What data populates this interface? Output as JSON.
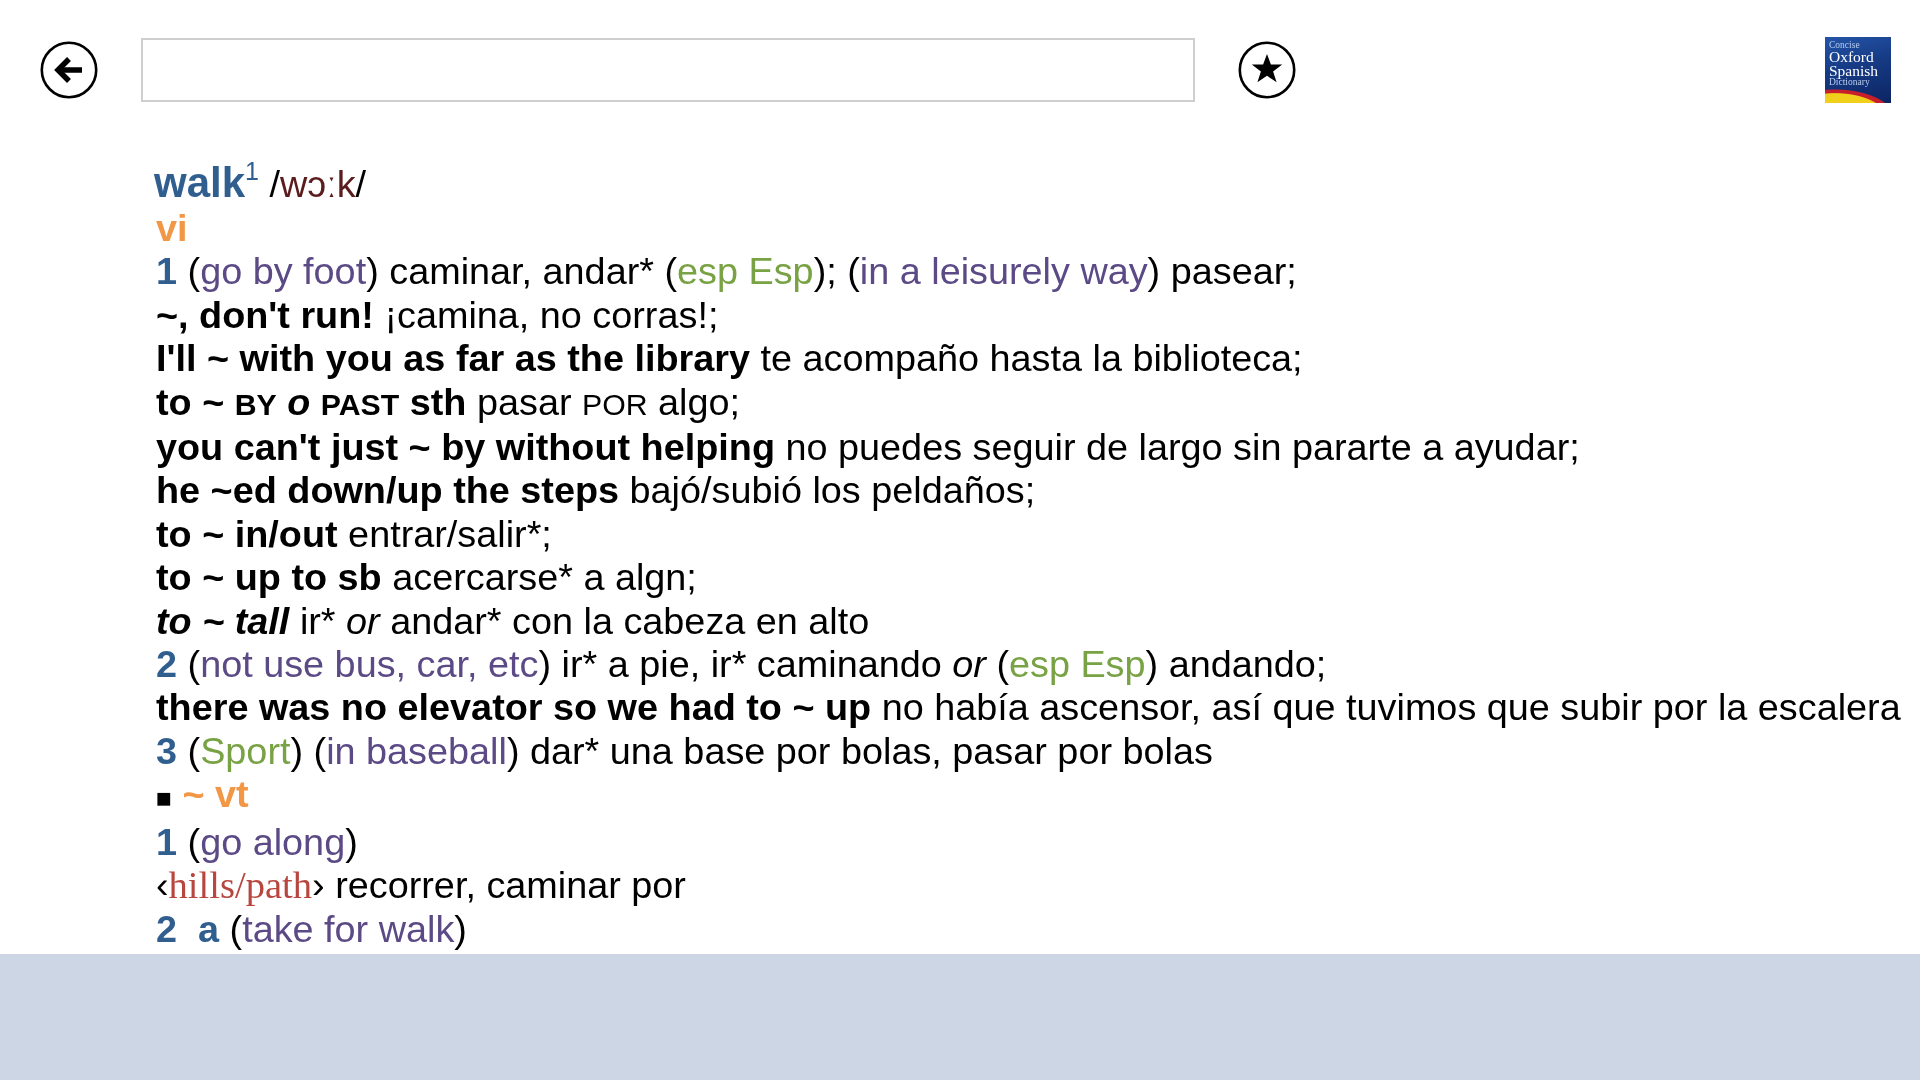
{
  "logo": {
    "lines": [
      {
        "kind": "minor",
        "text": "Concise"
      },
      {
        "kind": "major",
        "text": "Oxford"
      },
      {
        "kind": "major",
        "text": "Spanish"
      },
      {
        "kind": "minor",
        "text": "Dictionary"
      }
    ]
  },
  "entry": {
    "lines": [
      {
        "kind": "headword",
        "segments": [
          {
            "kind": "headword",
            "text": "walk"
          },
          {
            "kind": "homograph",
            "text": "1"
          },
          {
            "kind": "plain",
            "text": " /"
          },
          {
            "kind": "phonetic",
            "text": "wɔːk"
          },
          {
            "kind": "plain",
            "text": "/"
          }
        ]
      },
      {
        "kind": "pos",
        "segments": [
          {
            "kind": "pos",
            "text": "vi"
          }
        ]
      },
      {
        "kind": "sense",
        "segments": [
          {
            "kind": "number",
            "text": "1"
          },
          {
            "kind": "plain",
            "text": " ("
          },
          {
            "kind": "indicator",
            "text": "go by foot"
          },
          {
            "kind": "plain",
            "text": ") caminar, andar* ("
          },
          {
            "kind": "label",
            "text": "esp Esp"
          },
          {
            "kind": "plain",
            "text": "); ("
          },
          {
            "kind": "indicator",
            "text": "in a leisurely way"
          },
          {
            "kind": "plain",
            "text": ") pasear;"
          }
        ]
      },
      {
        "kind": "example",
        "segments": [
          {
            "kind": "phrase",
            "text": "~, don't run!"
          },
          {
            "kind": "plain",
            "text": " ¡camina, no corras!;"
          }
        ]
      },
      {
        "kind": "example",
        "segments": [
          {
            "kind": "phrase",
            "text": "I'll ~ with you as far as the library"
          },
          {
            "kind": "plain",
            "text": " te acompaño hasta la biblioteca;"
          }
        ]
      },
      {
        "kind": "example",
        "segments": [
          {
            "kind": "phrase",
            "text": "to ~ "
          },
          {
            "kind": "phrase_caps",
            "text": "BY"
          },
          {
            "kind": "phrase_italic",
            "text": " o "
          },
          {
            "kind": "phrase_caps",
            "text": "PAST"
          },
          {
            "kind": "phrase",
            "text": " sth"
          },
          {
            "kind": "plain",
            "text": " pasar "
          },
          {
            "kind": "caps",
            "text": "POR"
          },
          {
            "kind": "plain",
            "text": " algo;"
          }
        ]
      },
      {
        "kind": "example",
        "segments": [
          {
            "kind": "phrase",
            "text": "you can't just ~ by without helping"
          },
          {
            "kind": "plain",
            "text": " no puedes seguir de largo sin pararte a ayudar;"
          }
        ]
      },
      {
        "kind": "example",
        "segments": [
          {
            "kind": "phrase",
            "text": "he ~ed down/up the steps"
          },
          {
            "kind": "plain",
            "text": " bajó/subió los peldaños;"
          }
        ]
      },
      {
        "kind": "example",
        "segments": [
          {
            "kind": "phrase",
            "text": "to ~ in/out"
          },
          {
            "kind": "plain",
            "text": " entrar/salir*;"
          }
        ]
      },
      {
        "kind": "example",
        "segments": [
          {
            "kind": "phrase",
            "text": "to ~ up to sb"
          },
          {
            "kind": "plain",
            "text": " acercarse* a algn;"
          }
        ]
      },
      {
        "kind": "example",
        "segments": [
          {
            "kind": "phrase_italic",
            "text": "to ~ tall"
          },
          {
            "kind": "plain",
            "text": " ir* "
          },
          {
            "kind": "italic",
            "text": "or"
          },
          {
            "kind": "plain",
            "text": " andar* con la cabeza en alto"
          }
        ]
      },
      {
        "kind": "sense",
        "segments": [
          {
            "kind": "number",
            "text": "2"
          },
          {
            "kind": "plain",
            "text": " ("
          },
          {
            "kind": "indicator",
            "text": "not use bus, car, etc"
          },
          {
            "kind": "plain",
            "text": ") ir* a pie, ir* caminando "
          },
          {
            "kind": "italic",
            "text": "or"
          },
          {
            "kind": "plain",
            "text": " ("
          },
          {
            "kind": "label",
            "text": "esp Esp"
          },
          {
            "kind": "plain",
            "text": ") andando;"
          }
        ]
      },
      {
        "kind": "example",
        "segments": [
          {
            "kind": "phrase",
            "text": "there was no elevator so we had to ~ up"
          },
          {
            "kind": "plain",
            "text": " no había ascensor, así que tuvimos que subir por la escalera"
          }
        ]
      },
      {
        "kind": "sense",
        "segments": [
          {
            "kind": "number",
            "text": "3"
          },
          {
            "kind": "plain",
            "text": " ("
          },
          {
            "kind": "label",
            "text": "Sport"
          },
          {
            "kind": "plain",
            "text": ") ("
          },
          {
            "kind": "indicator",
            "text": "in baseball"
          },
          {
            "kind": "plain",
            "text": ") dar* una base por bolas, pasar por bolas"
          }
        ]
      },
      {
        "kind": "pos",
        "segments": [
          {
            "kind": "bullet",
            "text": "■"
          },
          {
            "kind": "pos",
            "text": " ~ vt"
          }
        ]
      },
      {
        "kind": "sense",
        "segments": [
          {
            "kind": "number",
            "text": "1"
          },
          {
            "kind": "plain",
            "text": " ("
          },
          {
            "kind": "indicator",
            "text": "go along"
          },
          {
            "kind": "plain",
            "text": ")"
          }
        ]
      },
      {
        "kind": "collocate",
        "segments": [
          {
            "kind": "plain",
            "text": "‹"
          },
          {
            "kind": "collocate",
            "text": "hills/path"
          },
          {
            "kind": "plain",
            "text": "› recorrer, caminar por"
          }
        ]
      },
      {
        "kind": "sense",
        "segments": [
          {
            "kind": "number",
            "text": "2  a"
          },
          {
            "kind": "plain",
            "text": " ("
          },
          {
            "kind": "indicator",
            "text": "take for walk"
          },
          {
            "kind": "plain",
            "text": ")"
          }
        ]
      }
    ]
  }
}
